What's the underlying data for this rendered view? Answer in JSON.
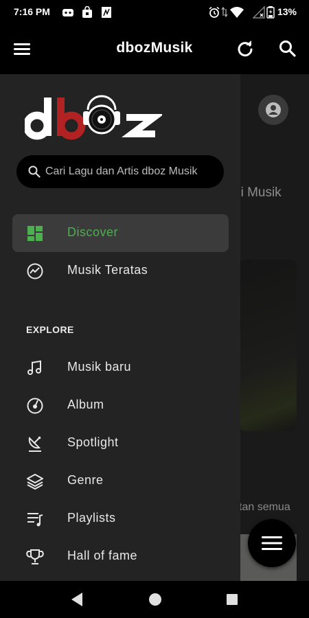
{
  "status_bar": {
    "time": "7:16 PM",
    "battery": "13%",
    "icons": [
      "gamepad-icon",
      "shopping-bag-icon",
      "image-icon",
      "alarm-icon",
      "data-arrows-icon",
      "wifi-icon",
      "signal-icon",
      "battery-icon"
    ]
  },
  "app_bar": {
    "title": "dbozMusik",
    "menu_icon": "hamburger-menu-icon",
    "refresh_icon": "refresh-icon",
    "search_icon": "search-icon"
  },
  "drawer": {
    "logo_text": "dboz",
    "search": {
      "placeholder": "Cari Lagu dan Artis dboz Musik"
    },
    "primary_items": [
      {
        "label": "Discover",
        "icon": "dashboard-icon",
        "active": true
      },
      {
        "label": "Musik Teratas",
        "icon": "trending-icon",
        "active": false
      }
    ],
    "section_title": "EXPLORE",
    "explore_items": [
      {
        "label": "Musik baru",
        "icon": "music-note-icon"
      },
      {
        "label": "Album",
        "icon": "album-icon"
      },
      {
        "label": "Spotlight",
        "icon": "satellite-dish-icon"
      },
      {
        "label": "Genre",
        "icon": "layers-icon"
      },
      {
        "label": "Playlists",
        "icon": "playlist-icon"
      },
      {
        "label": "Hall of fame",
        "icon": "trophy-icon"
      }
    ]
  },
  "background": {
    "heading_fragment": "pi Musik",
    "link_fragment": "tan semua"
  },
  "colors": {
    "accent": "#4caf50",
    "logo_red": "#b22222",
    "drawer_bg": "#232323",
    "active_item_bg": "#3b3b3b"
  }
}
